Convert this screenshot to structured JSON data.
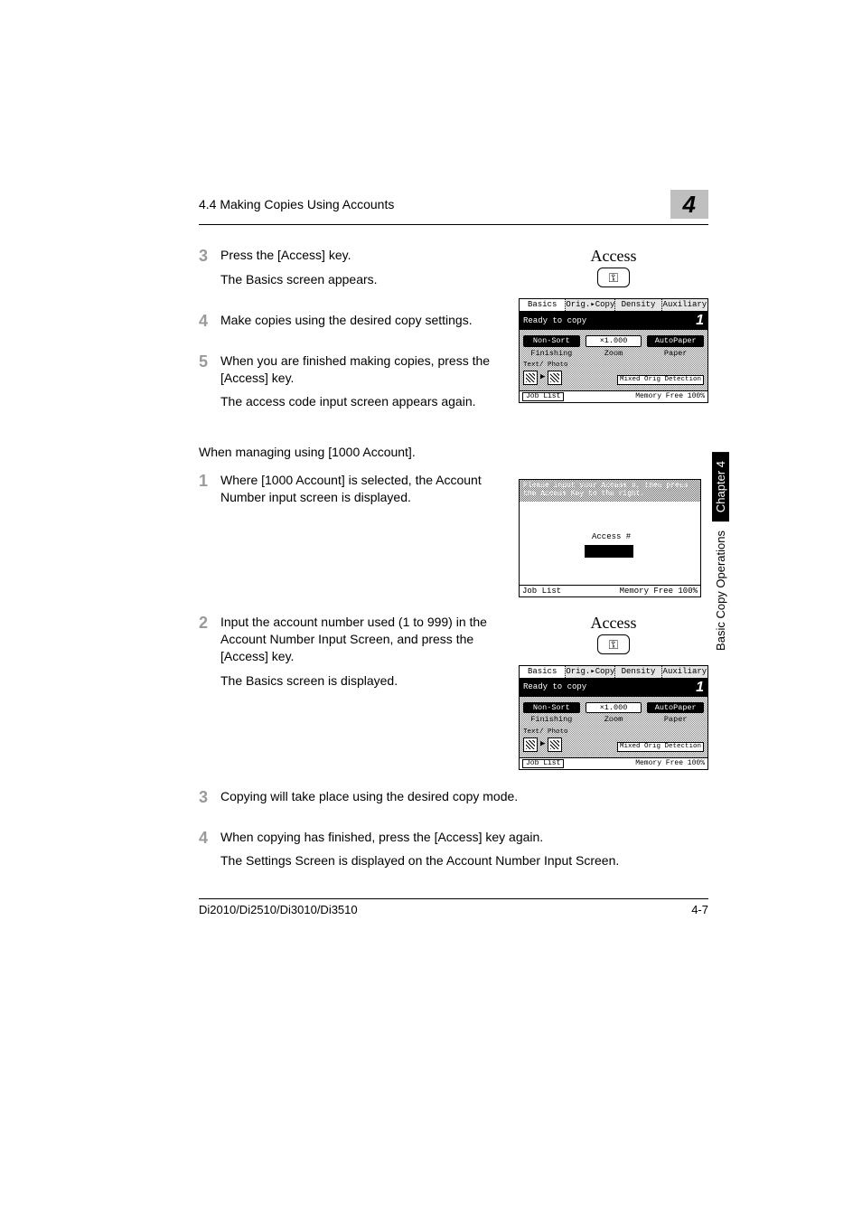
{
  "header": {
    "section_title": "4.4 Making Copies Using Accounts",
    "chapter_num": "4"
  },
  "side_tab": {
    "black": "Chapter 4",
    "white": "Basic Copy Operations"
  },
  "steps_top": [
    {
      "n": "3",
      "lines": [
        "Press the [Access] key.",
        "The Basics screen appears."
      ]
    },
    {
      "n": "4",
      "lines": [
        "Make copies using the desired copy settings."
      ]
    },
    {
      "n": "5",
      "lines": [
        "When you are finished making copies, press the [Access] key.",
        "The access code input screen appears again."
      ]
    }
  ],
  "intermediate": "When managing using [1000 Account].",
  "steps_mid": [
    {
      "n": "1",
      "lines": [
        "Where [1000 Account] is selected, the Account Number input screen is displayed."
      ]
    },
    {
      "n": "2",
      "lines": [
        "Input the account number used (1 to 999) in the Account Number Input Screen, and press the [Access] key.",
        "The Basics screen is displayed."
      ]
    }
  ],
  "steps_bottom": [
    {
      "n": "3",
      "lines": [
        "Copying will take place using the desired copy mode."
      ]
    },
    {
      "n": "4",
      "lines": [
        "When copying has finished, press the [Access] key again.",
        "The Settings Screen is displayed on the Account Number Input Screen."
      ]
    }
  ],
  "access_key": {
    "label": "Access",
    "glyph": "⚿"
  },
  "lcd": {
    "tabs": [
      "Basics",
      "Orig.▸Copy",
      "Density",
      "Auxiliary"
    ],
    "status": "Ready to copy",
    "count": "1",
    "row1": [
      "Non-Sort",
      "×1.000",
      "AutoPaper"
    ],
    "row2": [
      "Finishing",
      "Zoom",
      "Paper"
    ],
    "txtphoto": "Text/\nPhoto",
    "mixed": "Mixed Orig\nDetection",
    "joblist": "Job List",
    "memory": "Memory\nFree 100%"
  },
  "lcd2": {
    "msg": "Please input your Access #, then press\nthe Access Key to the right.",
    "field_label": "Access #",
    "joblist": "Job List",
    "memory": "Memory\nFree 100%"
  },
  "footer": {
    "left": "Di2010/Di2510/Di3010/Di3510",
    "right": "4-7"
  }
}
